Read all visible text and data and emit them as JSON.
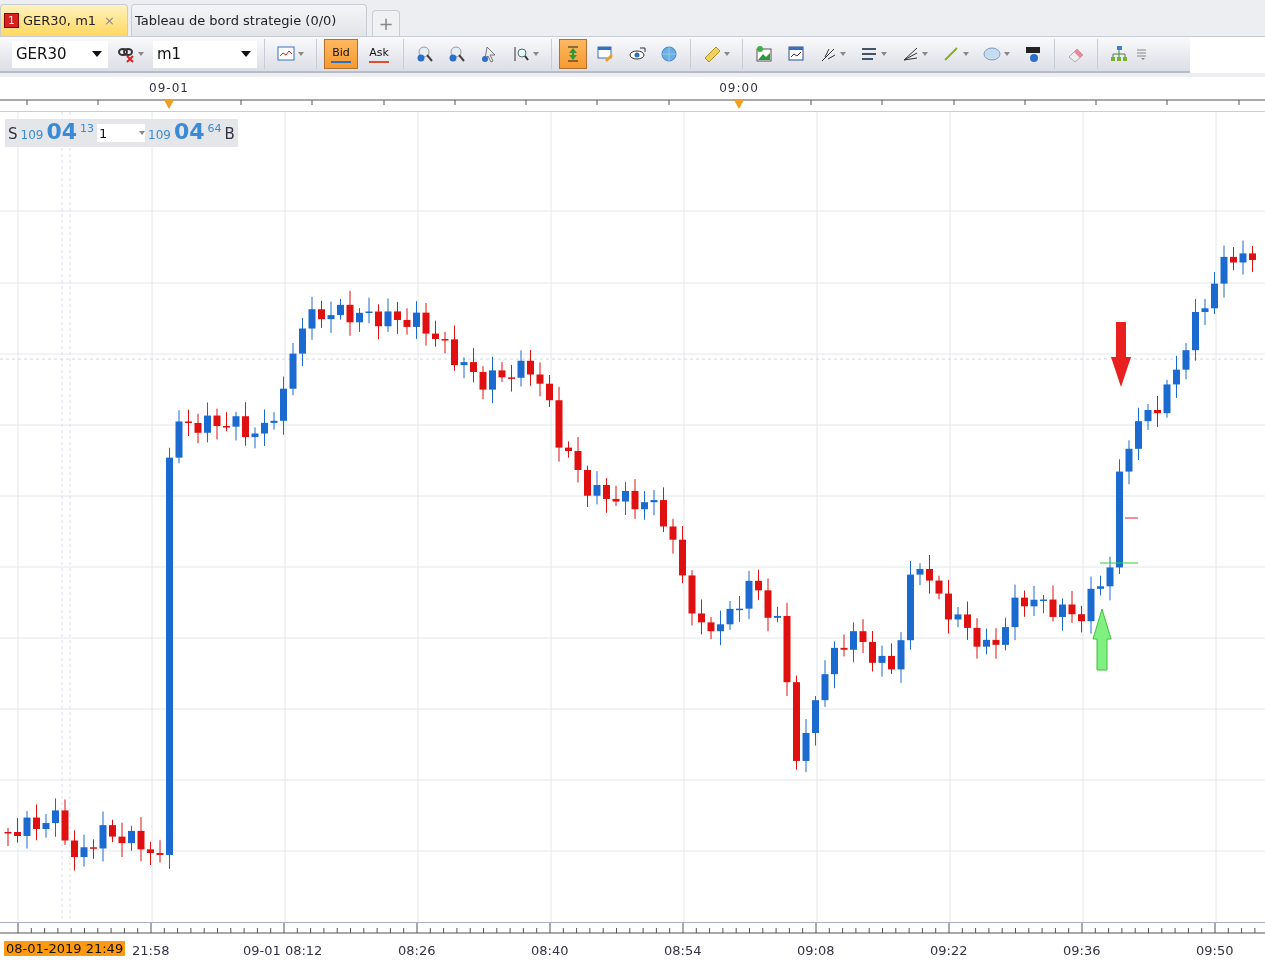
{
  "tabs": [
    {
      "badge": "1",
      "label": "GER30, m1",
      "close": "×",
      "selected": true
    },
    {
      "label": "Tableau de bord strategie (0/0)",
      "selected": false
    }
  ],
  "new_tab": "+",
  "toolbar": {
    "symbol": "GER30",
    "timeframe": "m1",
    "price_buttons": [
      {
        "label": "Bid",
        "selected": true
      },
      {
        "label": "Ask",
        "selected": false
      }
    ],
    "tools": [
      {
        "selected": false,
        "dropdown": false
      },
      {
        "selected": false,
        "dropdown": false
      },
      {
        "selected": false,
        "dropdown": false
      },
      {
        "selected": false,
        "dropdown": true
      },
      {
        "selected": true,
        "dropdown": false
      },
      {
        "selected": false,
        "dropdown": false
      },
      {
        "selected": false,
        "dropdown": false
      },
      {
        "selected": false,
        "dropdown": false
      },
      {
        "selected": false,
        "dropdown": true
      },
      {
        "selected": false,
        "dropdown": false
      },
      {
        "selected": false,
        "dropdown": false
      },
      {
        "selected": false,
        "dropdown": true
      },
      {
        "selected": false,
        "dropdown": true
      },
      {
        "selected": false,
        "dropdown": true
      },
      {
        "selected": false,
        "dropdown": true
      },
      {
        "selected": false,
        "dropdown": true
      },
      {
        "selected": false,
        "dropdown": false
      },
      {
        "selected": false,
        "dropdown": false
      },
      {
        "selected": false,
        "dropdown": false
      }
    ]
  },
  "top_axis": [
    "09-01",
    "09:00"
  ],
  "price_panel": {
    "sell_label": "S",
    "sell_prefix": "109",
    "sell_big": "04",
    "sell_pips": "13",
    "quantity": "1",
    "buy_prefix": "109",
    "buy_big": "04",
    "buy_pips": "64",
    "buy_label": "B"
  },
  "bottom_axis": [
    {
      "label": "08-01-2019 21:49",
      "highlighted": true
    },
    {
      "label": "21:58",
      "highlighted": false
    },
    {
      "label": "09-01 08:12",
      "highlighted": false
    },
    {
      "label": "08:26",
      "highlighted": false
    },
    {
      "label": "08:40",
      "highlighted": false
    },
    {
      "label": "08:54",
      "highlighted": false
    },
    {
      "label": "09:08",
      "highlighted": false
    },
    {
      "label": "09:22",
      "highlighted": false
    },
    {
      "label": "09:36",
      "highlighted": false
    },
    {
      "label": "09:50",
      "highlighted": false
    }
  ]
}
